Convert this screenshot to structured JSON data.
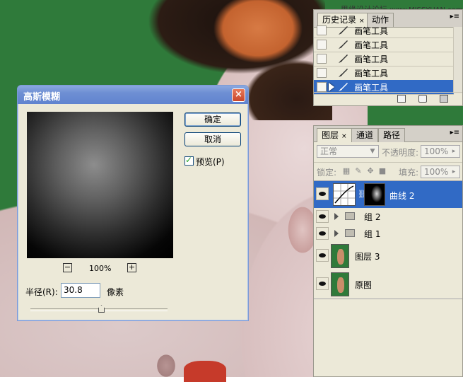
{
  "watermark": {
    "cn": "思缘设计论坛",
    "url": "www.MISSYUAN.com"
  },
  "history_panel": {
    "tabs": [
      {
        "label": "历史记录",
        "close": "×"
      },
      {
        "label": "动作"
      }
    ],
    "items": [
      {
        "label": "画笔工具"
      },
      {
        "label": "画笔工具"
      },
      {
        "label": "画笔工具"
      },
      {
        "label": "画笔工具"
      },
      {
        "label": "画笔工具",
        "selected": true
      }
    ]
  },
  "layers_panel": {
    "tabs": [
      {
        "label": "图层",
        "close": "×"
      },
      {
        "label": "通道"
      },
      {
        "label": "路径"
      }
    ],
    "blend_mode": "正常",
    "opacity_label": "不透明度:",
    "opacity_value": "100%",
    "lock_label": "锁定:",
    "fill_label": "填充:",
    "fill_value": "100%",
    "layers": [
      {
        "name": "曲线 2",
        "type": "adjustment",
        "selected": true
      },
      {
        "name": "组 2",
        "type": "group"
      },
      {
        "name": "组 1",
        "type": "group"
      },
      {
        "name": "图层 3",
        "type": "pixel"
      },
      {
        "name": "原图",
        "type": "pixel"
      }
    ]
  },
  "dialog": {
    "title": "高斯模糊",
    "close": "×",
    "ok_label": "确定",
    "cancel_label": "取消",
    "preview_label": "预览(P)",
    "preview_checked": true,
    "zoom_out": "−",
    "zoom_in": "+",
    "zoom_level": "100%",
    "radius_label": "半径(R):",
    "radius_value": "30.8",
    "unit_label": "像素",
    "radius_slider_fraction": 0.55
  },
  "colors": {
    "accent": "#316ac5",
    "background_green": "#2f7a3a",
    "panel": "#ece9d8"
  }
}
